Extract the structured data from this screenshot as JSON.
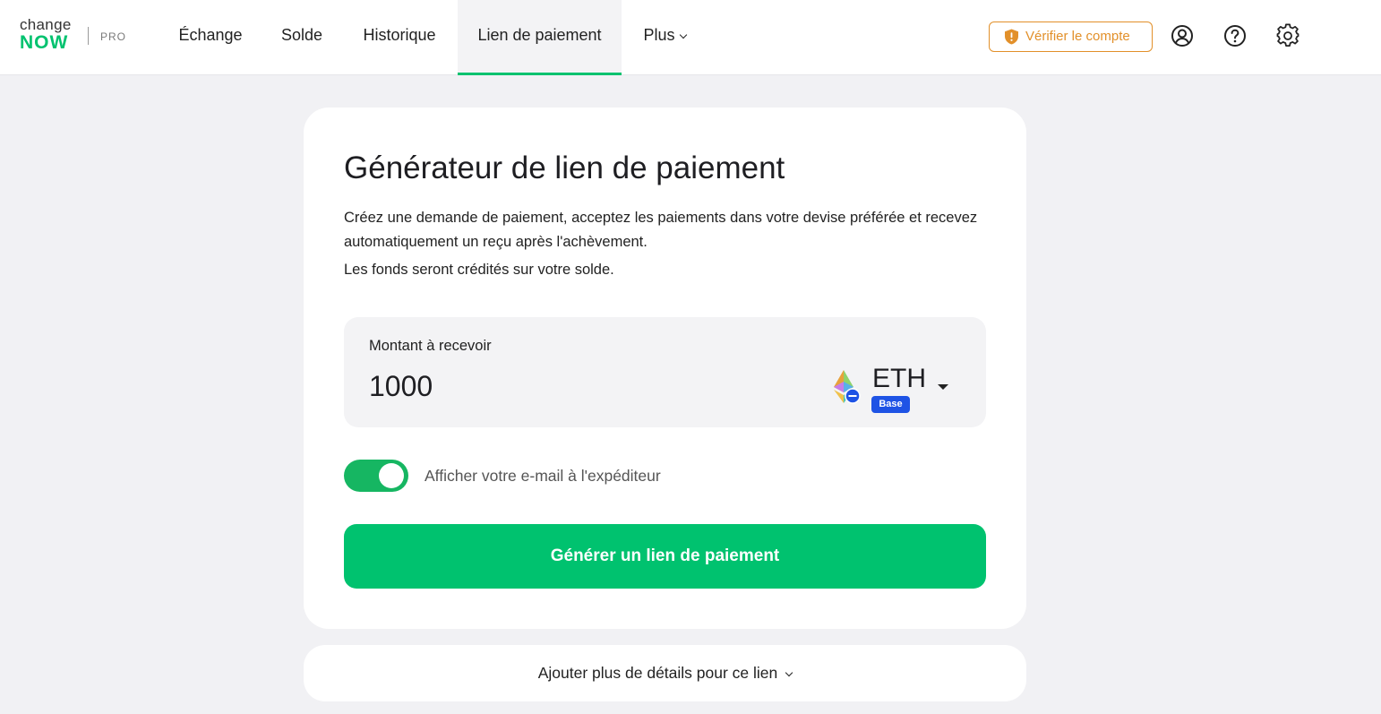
{
  "brand": {
    "change": "change",
    "now": "NOW",
    "pro": "PRO"
  },
  "nav": {
    "items": [
      {
        "label": "Échange"
      },
      {
        "label": "Solde"
      },
      {
        "label": "Historique"
      },
      {
        "label": "Lien de paiement"
      },
      {
        "label": "Plus"
      }
    ],
    "active": "Lien de paiement"
  },
  "header": {
    "verify_label": "Vérifier le compte",
    "icons": [
      "profile-icon",
      "help-icon",
      "settings-icon"
    ]
  },
  "card": {
    "title": "Générateur de lien de paiement",
    "description": "Créez une demande de paiement, acceptez les paiements dans votre devise préférée et recevez automatiquement un reçu après l'achèvement.",
    "note": "Les fonds seront crédités sur votre solde.",
    "amount": {
      "label": "Montant à recevoir",
      "value": "1000",
      "currency": "ETH",
      "network": "Base"
    },
    "toggle": {
      "label": "Afficher votre e-mail à l'expéditeur",
      "on": true
    },
    "generate_label": "Générer un lien de paiement"
  },
  "details": {
    "label": "Ajouter plus de détails pour ce lien"
  },
  "colors": {
    "accent": "#00c26f",
    "warning": "#e2902a",
    "badge": "#1e53e5",
    "background": "#f1f1f4"
  }
}
